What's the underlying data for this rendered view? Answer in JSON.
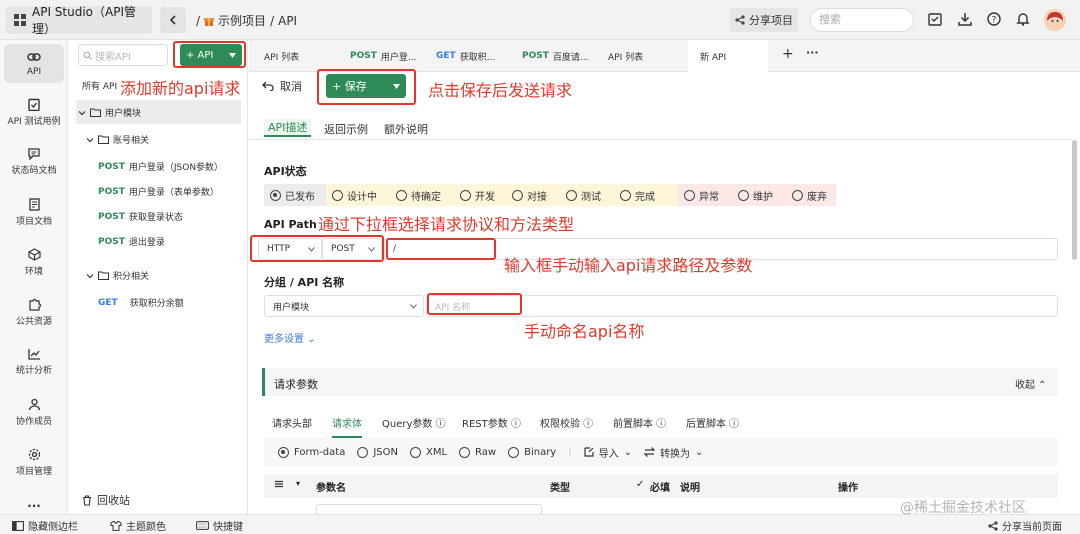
{
  "app": {
    "title": "API Studio（API管理）",
    "breadcrumb_sep": "/",
    "breadcrumb_project": "示例项目",
    "breadcrumb_page": "API"
  },
  "topbar": {
    "share": "分享项目",
    "search_placeholder": "搜索"
  },
  "nav": [
    "API",
    "API 测试用例",
    "状态码文档",
    "项目文档",
    "环境",
    "公共资源",
    "统计分析",
    "协作成员",
    "项目管理",
    "..."
  ],
  "tree": {
    "search_placeholder": "搜索API",
    "add_button": "+ API",
    "all_api": "所有 API",
    "group_user": "用户模块",
    "group_account": "账号相关",
    "account_items": [
      {
        "method": "POST",
        "name": "用户登录（JSON参数）"
      },
      {
        "method": "POST",
        "name": "用户登录（表单参数）"
      },
      {
        "method": "POST",
        "name": "获取登录状态"
      },
      {
        "method": "POST",
        "name": "退出登录"
      }
    ],
    "group_points": "积分相关",
    "points_items": [
      {
        "method": "GET",
        "name": "获取积分余额"
      }
    ],
    "recycle": "回收站"
  },
  "tabs": [
    {
      "method": "",
      "label": "API 列表"
    },
    {
      "method": "POST",
      "label": "用户登..."
    },
    {
      "method": "GET",
      "label": "获取积..."
    },
    {
      "method": "POST",
      "label": "百度请..."
    },
    {
      "method": "",
      "label": "API 列表"
    },
    {
      "method": "",
      "label": "新 API"
    }
  ],
  "tab_add": "+",
  "tab_more": "···",
  "editor": {
    "cancel": "取消",
    "save": "+ 保存",
    "subtabs": [
      "API描述",
      "返回示例",
      "额外说明"
    ],
    "status_label": "API状态",
    "statuses": [
      "已发布",
      "设计中",
      "待确定",
      "开发",
      "对接",
      "测试",
      "完成",
      "异常",
      "维护",
      "废弃"
    ],
    "status_colors": [
      "#ececec",
      "#fdf6d8",
      "#fdf6d8",
      "#fdf6d8",
      "#fdf6d8",
      "#fdf6d8",
      "#fdf6d8",
      "#fde8e8",
      "#fde8e8",
      "#fde8e8"
    ],
    "path_label": "API Path",
    "protocol": "HTTP",
    "method": "POST",
    "path_value": "/",
    "group_label": "分组 / API 名称",
    "group_value": "用户模块",
    "name_placeholder": "API 名称",
    "more_settings": "更多设置"
  },
  "request": {
    "title": "请求参数",
    "collapse": "收起",
    "tabs": [
      "请求头部",
      "请求体",
      "Query参数",
      "REST参数",
      "权限校验",
      "前置脚本",
      "后置脚本"
    ],
    "body_types": [
      "Form-data",
      "JSON",
      "XML",
      "Raw",
      "Binary"
    ],
    "import": "导入",
    "convert": "转换为",
    "columns": [
      "参数名",
      "类型",
      "必填",
      "说明",
      "操作"
    ]
  },
  "bottom": {
    "hide_sidebar": "隐藏侧边栏",
    "theme": "主题颜色",
    "shortcuts": "快捷键",
    "share_page": "分享当前页面"
  },
  "annotations": {
    "add_api": "添加新的api请求",
    "save": "点击保存后发送请求",
    "select": "通过下拉框选择请求协议和方法类型",
    "input": "输入框手动输入api请求路径及参数",
    "name": "手动命名api名称"
  },
  "watermark": "@稀土掘金技术社区",
  "colors": {
    "accent": "#2e8b57",
    "annotation": "#e0392b",
    "get": "#3b7de0"
  }
}
